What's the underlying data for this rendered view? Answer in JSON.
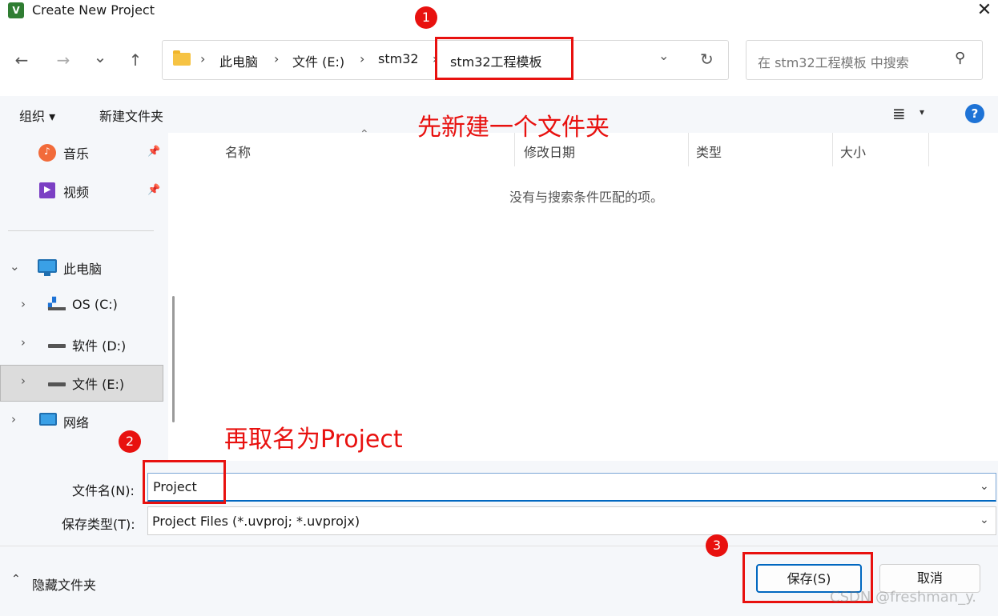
{
  "window": {
    "title": "Create New Project",
    "app_icon_letter": "V",
    "close_glyph": "✕"
  },
  "nav": {
    "back": "←",
    "forward": "→",
    "recent": "⌄",
    "up": "↑",
    "breadcrumbs": [
      "此电脑",
      "文件 (E:)",
      "stm32",
      "stm32工程模板"
    ],
    "breadcrumb_sep": "›",
    "address_dropdown": "⌄",
    "refresh": "↻",
    "search_placeholder": "在 stm32工程模板 中搜索"
  },
  "toolbar": {
    "organize_label": "组织 ▾",
    "new_folder_label": "新建文件夹",
    "view_glyph": "≣",
    "view_chev": "▾",
    "help_glyph": "?"
  },
  "sidebar": {
    "quick_items": [
      {
        "label": "音乐",
        "icon": "music-icon"
      },
      {
        "label": "视频",
        "icon": "video-icon"
      }
    ],
    "this_pc": "此电脑",
    "drives": [
      {
        "label": "OS (C:)",
        "icon": "windows-drive-icon"
      },
      {
        "label": "软件 (D:)",
        "icon": "drive-icon"
      },
      {
        "label": "文件 (E:)",
        "icon": "drive-icon",
        "selected": true
      }
    ],
    "network": "网络"
  },
  "file_list": {
    "columns": [
      "名称",
      "修改日期",
      "类型",
      "大小"
    ],
    "empty_message": "没有与搜索条件匹配的项。"
  },
  "form": {
    "filename_label": "文件名(N):",
    "filename_value": "Project",
    "filetype_label": "保存类型(T):",
    "filetype_value": "Project Files (*.uvproj; *.uvprojx)"
  },
  "footer": {
    "hide_folders": "隐藏文件夹",
    "hide_chev": "⌃",
    "save_label": "保存(S)",
    "cancel_label": "取消"
  },
  "annotations": {
    "badge1": "1",
    "badge2": "2",
    "badge3": "3",
    "note1": "先新建一个文件夹",
    "note2": "再取名为Project"
  },
  "watermark": "CSDN @freshman_y.",
  "colors": {
    "accent": "#0067c0",
    "annotation_red": "#e8110f",
    "folder": "#f6c343"
  }
}
